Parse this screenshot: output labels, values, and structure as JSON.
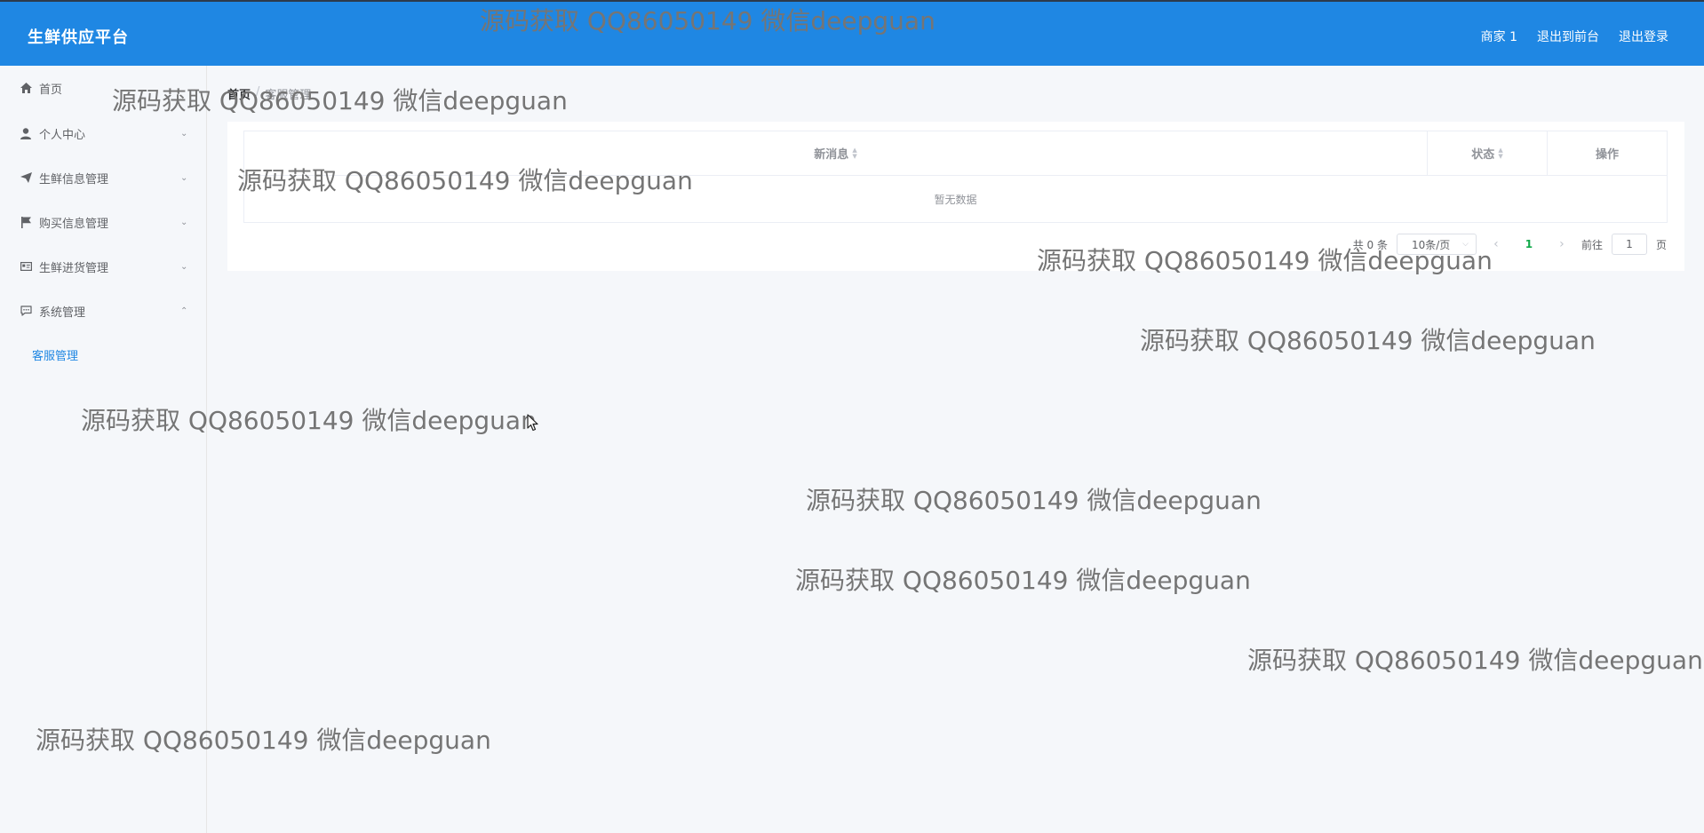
{
  "header": {
    "brand": "生鲜供应平台",
    "user": "商家 1",
    "back_to_front": "退出到前台",
    "logout": "退出登录",
    "bg_color": "#1f87e3"
  },
  "sidebar": {
    "items": [
      {
        "label": "首页",
        "icon": "home-icon"
      },
      {
        "label": "个人中心",
        "icon": "user-icon"
      },
      {
        "label": "生鲜信息管理",
        "icon": "paper-plane-icon"
      },
      {
        "label": "购买信息管理",
        "icon": "flag-icon"
      },
      {
        "label": "生鲜进货管理",
        "icon": "id-card-icon"
      },
      {
        "label": "系统管理",
        "icon": "chat-icon"
      }
    ],
    "active_sub": "客服管理",
    "active_color": "#1f87e3"
  },
  "breadcrumb": {
    "home": "首页",
    "separator": "/",
    "current": "客服管理"
  },
  "table": {
    "columns": [
      "新消息",
      "状态",
      "操作"
    ],
    "empty_text": "暂无数据"
  },
  "pagination": {
    "total": "共 0 条",
    "page_size": "10条/页",
    "current_page": "1",
    "goto_label": "前往",
    "goto_value": "1",
    "page_suffix": "页"
  },
  "watermark": "源码获取 QQ86050149 微信deepguan"
}
